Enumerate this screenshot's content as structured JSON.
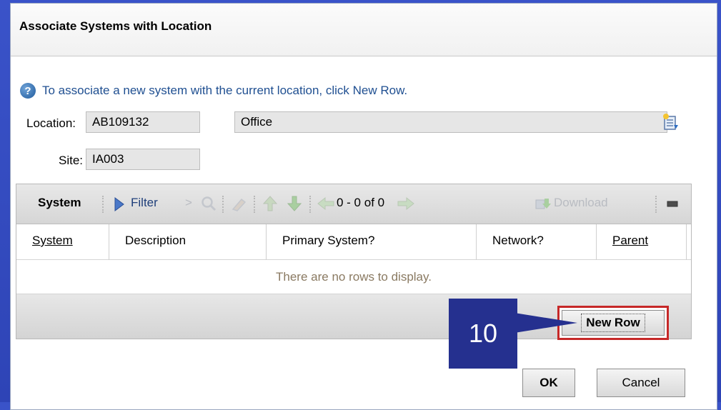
{
  "dialog": {
    "title": "Associate Systems with Location",
    "hint": "To associate a new system with the current location, click New Row.",
    "location_label": "Location:",
    "location_value": "AB109132",
    "location_desc": "Office",
    "site_label": "Site:",
    "site_value": "IA003"
  },
  "table": {
    "name": "System",
    "filter_label": "Filter",
    "pager": "0 - 0 of 0",
    "download_label": "Download",
    "columns": [
      "System",
      "Description",
      "Primary System?",
      "Network?",
      "Parent"
    ],
    "empty_message": "There are no rows to display.",
    "new_row_label": "New Row"
  },
  "callout": {
    "number": "10"
  },
  "buttons": {
    "ok": "OK",
    "cancel": "Cancel"
  },
  "colors": {
    "accent_blue": "#25308f",
    "highlight_red": "#c62828",
    "link_blue": "#1f4f91"
  }
}
